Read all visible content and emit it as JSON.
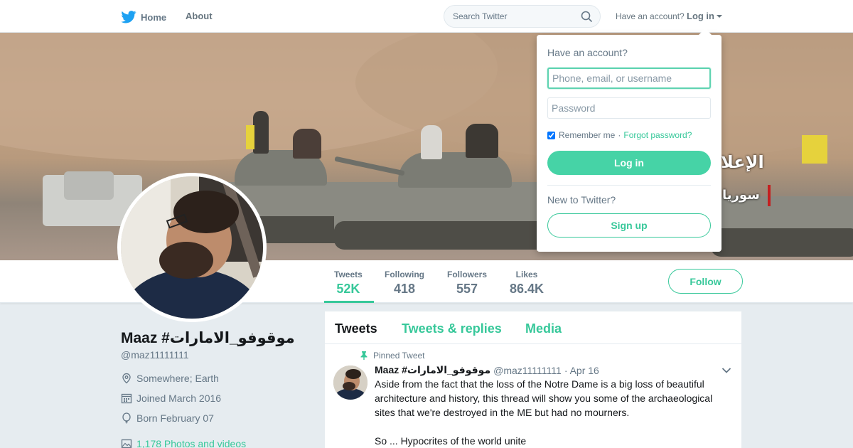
{
  "colors": {
    "accent": "#37c89a",
    "twitter_blue": "#1da1f2",
    "text": "#14171a",
    "muted": "#657786"
  },
  "nav": {
    "home_label": "Home",
    "home_icon": "twitter-bird-icon",
    "about_label": "About",
    "search_placeholder": "Search Twitter",
    "have_account": "Have an account?",
    "login_label": "Log in"
  },
  "banner": {
    "overlay_text_1": "الإعلا",
    "overlay_text_2": "سوريا"
  },
  "profile": {
    "name": "Maaz #موقوفو_الامارات",
    "handle": "@maz11111111",
    "location": "Somewhere; Earth",
    "joined": "Joined March 2016",
    "born": "Born February 07",
    "photos": "1,178 Photos and videos"
  },
  "stats": [
    {
      "label": "Tweets",
      "value": "52K"
    },
    {
      "label": "Following",
      "value": "418"
    },
    {
      "label": "Followers",
      "value": "557"
    },
    {
      "label": "Likes",
      "value": "86.4K"
    }
  ],
  "follow_label": "Follow",
  "tabs": [
    "Tweets",
    "Tweets & replies",
    "Media"
  ],
  "tweet": {
    "pinned_label": "Pinned Tweet",
    "name": "Maaz #موقوفو_الامارات",
    "handle": "@maz11111111",
    "date": "· Apr 16",
    "text_1": "Aside from the fact that the loss of the Notre Dame is a big loss of beautiful architecture and history, this thread will show you some of the archaeological sites that we're destroyed in the ME but had no mourners.",
    "text_2": "So ... Hypocrites of the world unite"
  },
  "login_dropdown": {
    "title": "Have an account?",
    "username_placeholder": "Phone, email, or username",
    "password_placeholder": "Password",
    "remember_label": "Remember me",
    "separator": "·",
    "forgot_label": "Forgot password?",
    "login_button": "Log in",
    "new_label": "New to Twitter?",
    "signup_button": "Sign up"
  }
}
